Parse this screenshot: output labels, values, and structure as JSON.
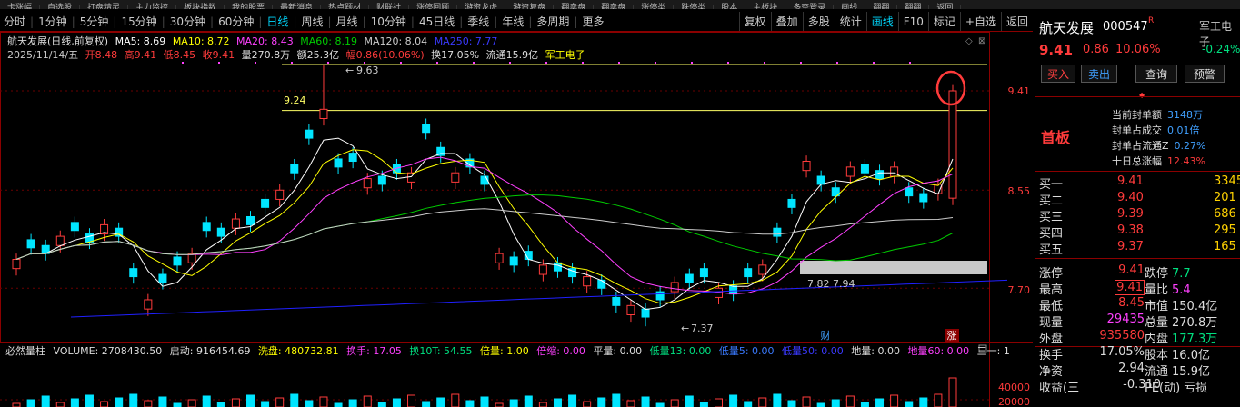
{
  "top_strip": [
    "卡涨幅",
    "自选股",
    "打盘精灵",
    "主力监控",
    "板块指数",
    "我的股票",
    "最新消息",
    "热点题材",
    "财联社",
    "涨停回顾",
    "游资龙虎",
    "游资复盘",
    "翻卖盘",
    "翻卖盘",
    "涨停类",
    "跌停类",
    "股本",
    "主板块",
    "多空登录",
    "画线",
    "翻翻",
    "翻翻",
    "返回"
  ],
  "periods": [
    "分时",
    "1分钟",
    "5分钟",
    "15分钟",
    "30分钟",
    "60分钟",
    "日线",
    "周线",
    "月线",
    "10分钟",
    "45日线",
    "季线",
    "年线",
    "多周期",
    "更多"
  ],
  "active_period": "日线",
  "tools": [
    "复权",
    "叠加",
    "多股",
    "统计",
    "画线",
    "F10",
    "标记",
    "+自选",
    "返回"
  ],
  "active_tool": "画线",
  "ma_line": {
    "title": "航天发展(日线,前复权)",
    "ma5": "MA5: 8.69",
    "ma10": "MA10: 8.72",
    "ma20": "MA20: 8.43",
    "ma60": "MA60: 8.19",
    "ma120": "MA120: 8.04",
    "ma250": "MA250: 7.77"
  },
  "info_line": {
    "date": "2025/11/14/五",
    "open": "开8.48",
    "high": "高9.41",
    "low": "低8.45",
    "close": "收9.41",
    "vol": "量270.8万",
    "amount": "额25.3亿",
    "amp": "幅0.86(10.06%)",
    "turnover": "换17.05%",
    "float": "流通15.9亿",
    "sector": "军工电子"
  },
  "chart_labels": {
    "high_label": "9.63",
    "level": "9.24",
    "low_label": "7.37",
    "mid1": "7.82",
    "mid2": "7.94",
    "yaxis": [
      "9.41",
      "8.55",
      "7.70"
    ],
    "marker_cai": "财",
    "marker_zhang": "涨"
  },
  "volume_panel": {
    "name": "必然量柱",
    "volume": "VOLUME: 2708430.50",
    "qidong": "启动: 916454.69",
    "xipan": "洗盘: 480732.81",
    "huanshou": "换手: 17.05",
    "huan10": "换10T: 54.55",
    "beiliang": "倍量: 1.00",
    "beisuo": "倍缩: 0.00",
    "pingliang": "平量: 0.00",
    "diliang13": "低量13: 0.00",
    "diliang5": "低量5: 0.00",
    "diliang50": "低量50: 0.00",
    "diliang": "地量: 0.00",
    "diliang60": "地量60: 0.00",
    "sanyi": "三一: 1",
    "yaxis": [
      "40000",
      "20000"
    ]
  },
  "quote": {
    "name": "航天发展",
    "code": "000547",
    "tag": "R",
    "sector": "军工电子",
    "sector_pct": "-0.24%",
    "price": "9.41",
    "change": "0.86",
    "change_pct": "10.06%",
    "buttons": [
      "买入",
      "卖出",
      "查询",
      "预警"
    ],
    "board": "首板",
    "seal": [
      {
        "k": "当前封单额",
        "v": "3148万"
      },
      {
        "k": "封单占成交",
        "v": "0.01倍"
      },
      {
        "k": "封单占流通Z",
        "v": "0.27%"
      },
      {
        "k": "十日总涨幅",
        "v": "12.43%"
      }
    ],
    "bids": [
      {
        "k": "买一",
        "p": "9.41",
        "v": "3345"
      },
      {
        "k": "买二",
        "p": "9.40",
        "v": "201"
      },
      {
        "k": "买三",
        "p": "9.39",
        "v": "686"
      },
      {
        "k": "买四",
        "p": "9.38",
        "v": "295"
      },
      {
        "k": "买五",
        "p": "9.37",
        "v": "165"
      }
    ],
    "stats": [
      {
        "k1": "涨停",
        "v1": "9.41",
        "k2": "跌停",
        "v2": "7.7"
      },
      {
        "k1": "最高",
        "v1": "9.41",
        "k2": "量比",
        "v2": "5.4"
      },
      {
        "k1": "最低",
        "v1": "8.45",
        "k2": "市值",
        "v2": "150.4亿"
      },
      {
        "k1": "现量",
        "v1": "29435",
        "k2": "总量",
        "v2": "270.8万"
      },
      {
        "k1": "外盘",
        "v1": "935580",
        "k2": "内盘",
        "v2": "177.3万"
      },
      {
        "k1": "换手",
        "v1": "17.05%",
        "k2": "股本",
        "v2": "16.0亿"
      },
      {
        "k1": "净资",
        "v1": "2.94",
        "k2": "流通",
        "v2": "15.9亿"
      },
      {
        "k1": "收益(三",
        "v1": "-0.310",
        "k2": "PE(动)",
        "v2": "亏损"
      }
    ]
  },
  "colors": {
    "up": "#ff3b3b",
    "down": "#00e5ff",
    "ma5": "#ffffff",
    "ma10": "#ffff00",
    "ma20": "#ff40ff",
    "ma60": "#00cc00",
    "ma120": "#cccccc",
    "ma250": "#2020ff"
  }
}
